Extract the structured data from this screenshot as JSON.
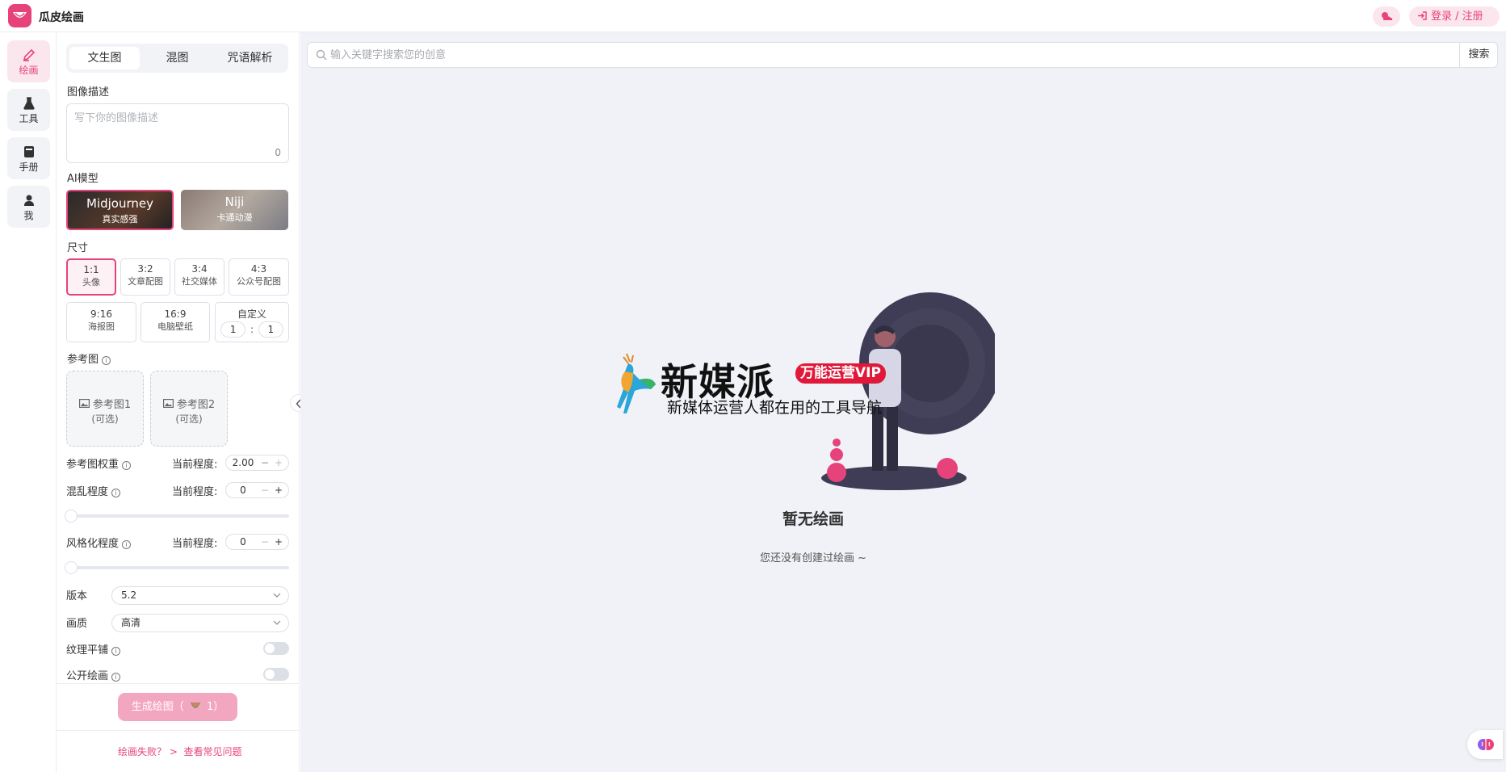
{
  "app": {
    "title": "瓜皮绘画"
  },
  "header": {
    "login_label": "登录 / 注册"
  },
  "rail": {
    "items": [
      {
        "label": "绘画",
        "icon": "brush-icon",
        "active": true
      },
      {
        "label": "工具",
        "icon": "flask-icon",
        "active": false
      },
      {
        "label": "手册",
        "icon": "book-icon",
        "active": false
      },
      {
        "label": "我",
        "icon": "user-icon",
        "active": false
      }
    ]
  },
  "panel": {
    "tabs": [
      "文生图",
      "混图",
      "咒语解析"
    ],
    "prompt": {
      "label": "图像描述",
      "placeholder": "写下你的图像描述",
      "count": "0"
    },
    "model": {
      "label": "AI模型",
      "options": [
        {
          "name": "Midjourney",
          "desc": "真实感强",
          "selected": true
        },
        {
          "name": "Niji",
          "desc": "卡通动漫",
          "selected": false
        }
      ]
    },
    "size": {
      "label": "尺寸",
      "options_row1": [
        {
          "ratio": "1:1",
          "desc": "头像",
          "selected": true
        },
        {
          "ratio": "3:2",
          "desc": "文章配图"
        },
        {
          "ratio": "3:4",
          "desc": "社交媒体"
        },
        {
          "ratio": "4:3",
          "desc": "公众号配图"
        }
      ],
      "options_row2": [
        {
          "ratio": "9:16",
          "desc": "海报图"
        },
        {
          "ratio": "16:9",
          "desc": "电脑壁纸"
        }
      ],
      "custom": {
        "label": "自定义",
        "w": "1",
        "sep": ":",
        "h": "1"
      }
    },
    "reference": {
      "label": "参考图",
      "slots": [
        {
          "label": "参考图1",
          "optional": "(可选)"
        },
        {
          "label": "参考图2",
          "optional": "(可选)"
        }
      ]
    },
    "weight": {
      "label": "参考图权重",
      "current_label": "当前程度:",
      "value": "2.00"
    },
    "chaos": {
      "label": "混乱程度",
      "current_label": "当前程度:",
      "value": "0",
      "level": 0
    },
    "stylize": {
      "label": "风格化程度",
      "current_label": "当前程度:",
      "value": "0",
      "level": 0
    },
    "version": {
      "label": "版本",
      "value": "5.2"
    },
    "quality": {
      "label": "画质",
      "value": "高清"
    },
    "tile": {
      "label": "纹理平铺",
      "on": false
    },
    "public": {
      "label": "公开绘画",
      "on": false
    },
    "generate": {
      "label": "生成绘图（",
      "count": "1）"
    },
    "help": {
      "fail": "绘画失败？ >",
      "faq": "查看常见问题"
    }
  },
  "main": {
    "search": {
      "placeholder": "输入关键字搜索您的创意",
      "button": "搜索"
    },
    "empty": {
      "title": "暂无绘画",
      "subtitle": "您还没有创建过绘画 ~"
    }
  },
  "watermark": {
    "title": "新媒派",
    "badge": "万能运营VIP",
    "subtitle": "新媒体运营人都在用的工具导航"
  },
  "colors": {
    "accent": "#e7437b",
    "accent_light": "#fbe6ed",
    "main_bg": "#f0f2f7"
  }
}
